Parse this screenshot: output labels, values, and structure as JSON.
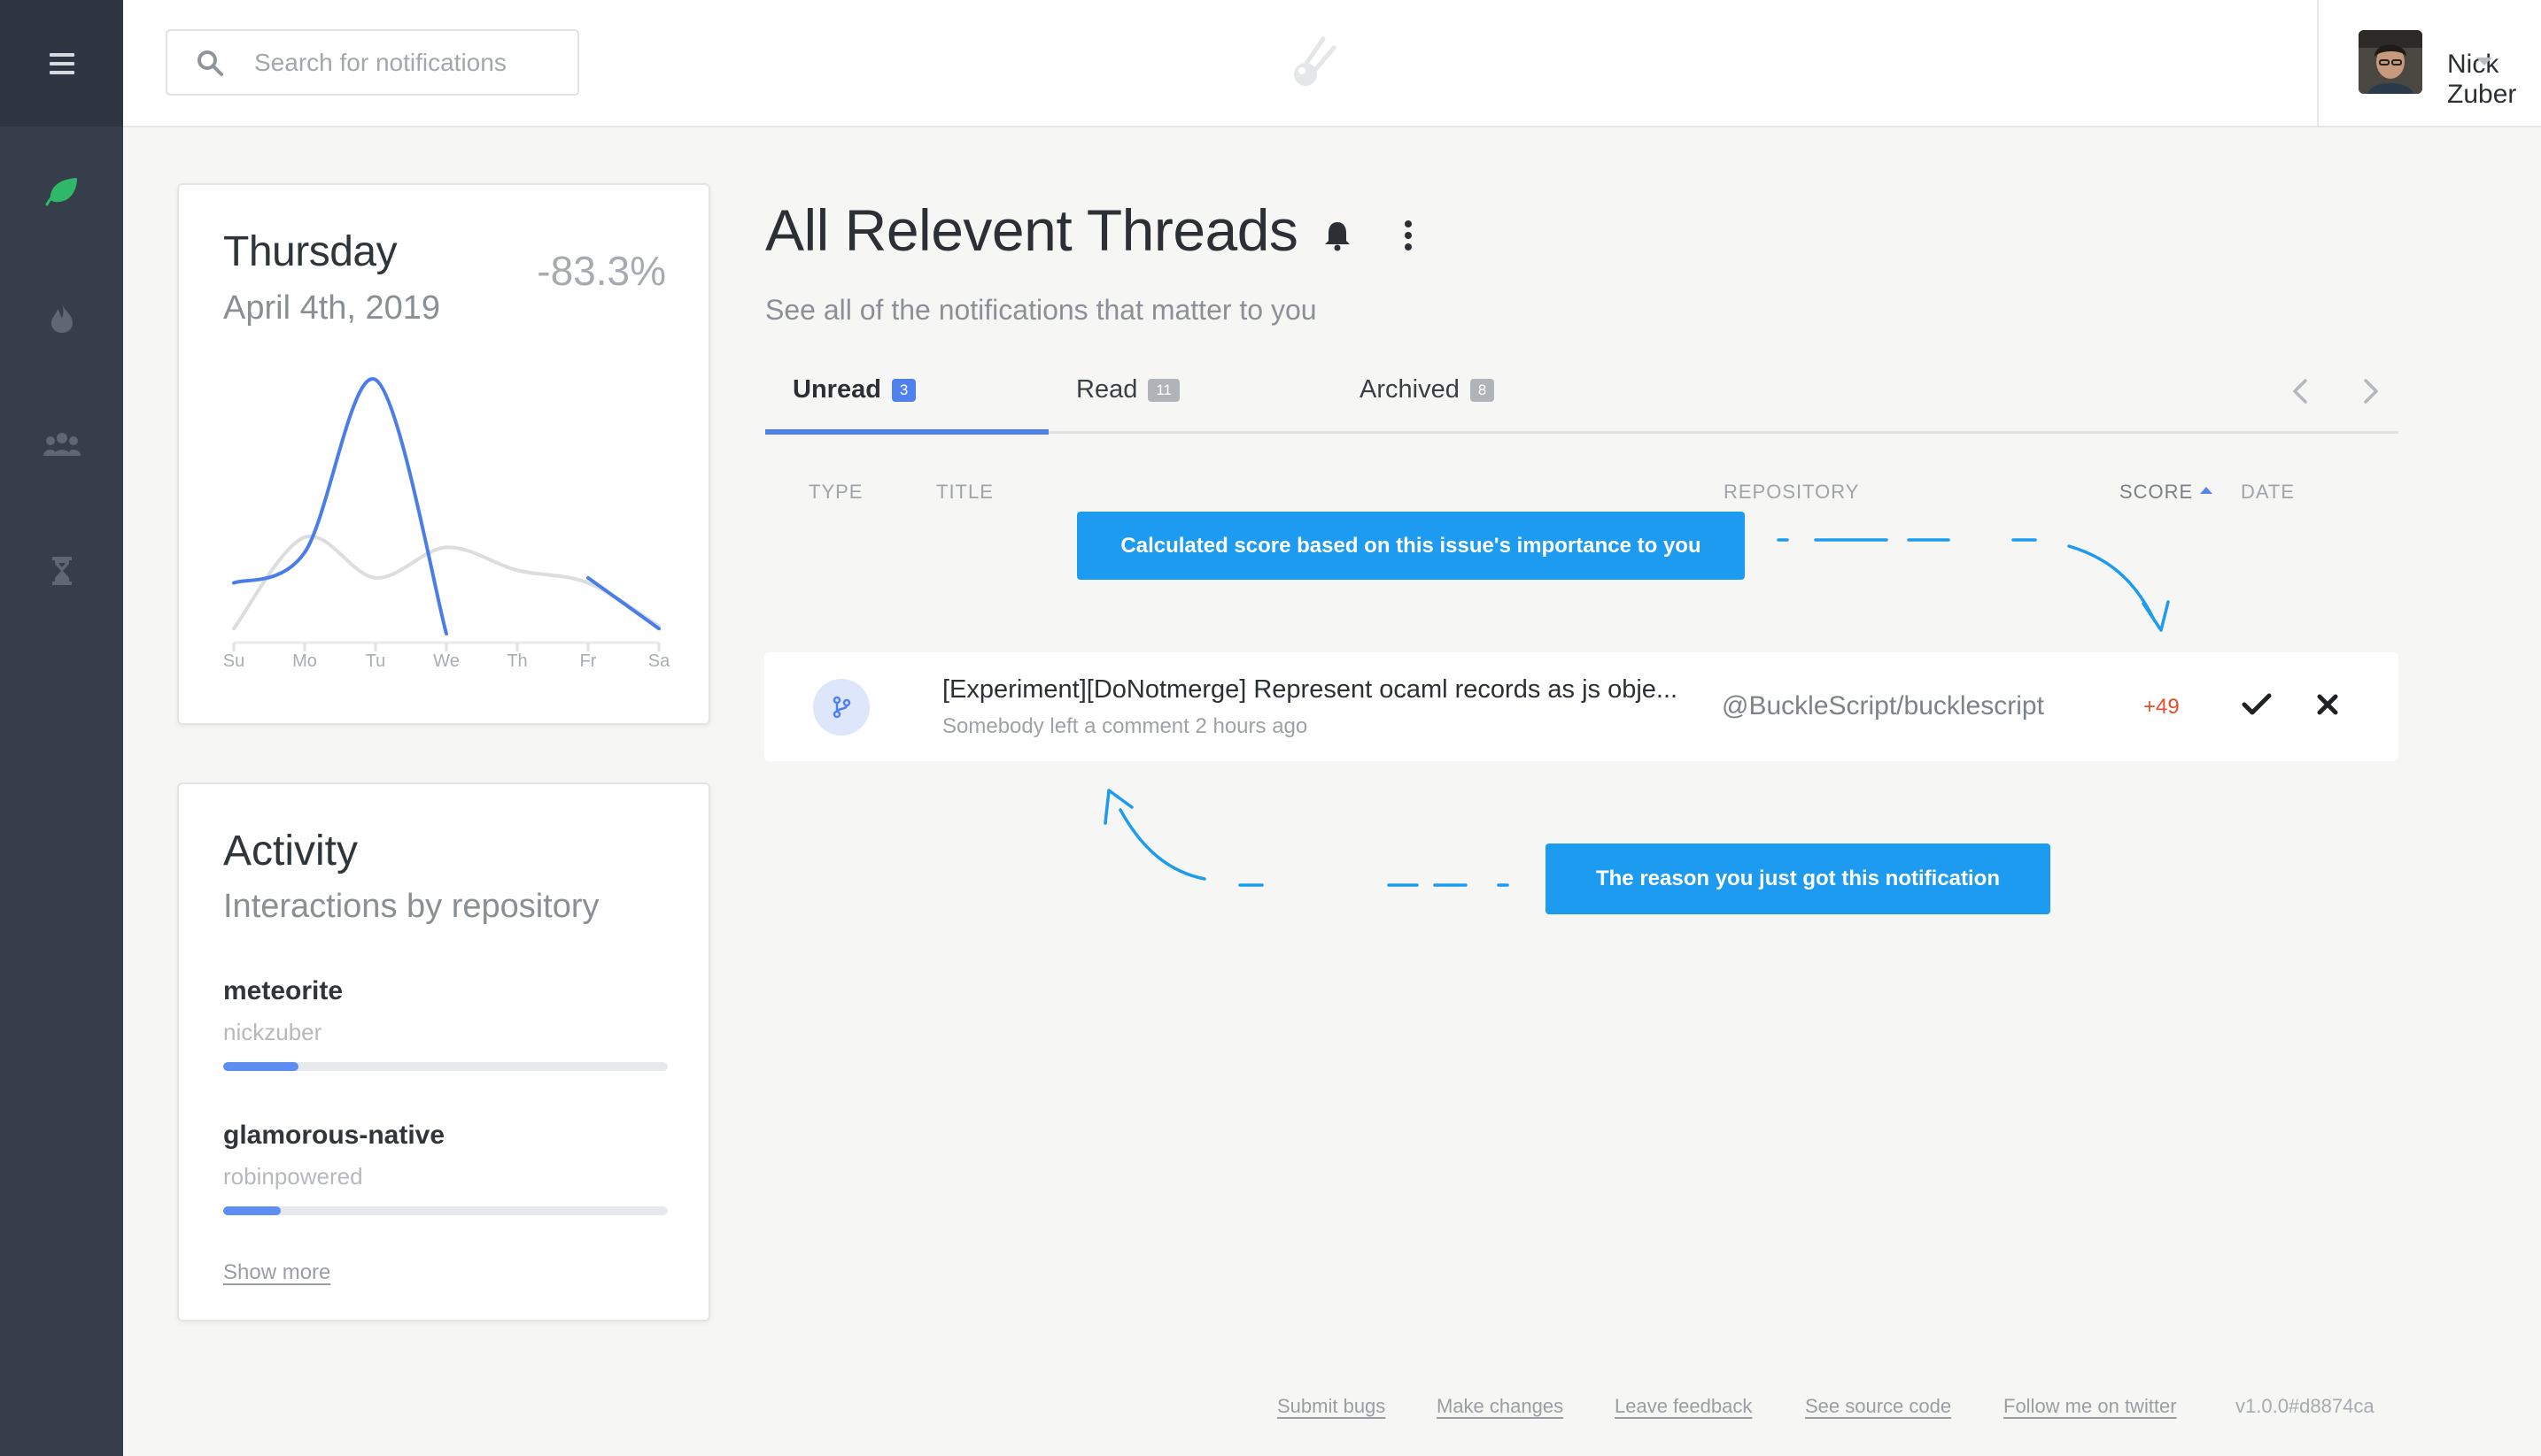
{
  "search": {
    "placeholder": "Search for notifications"
  },
  "user": {
    "name": "Nick Zuber"
  },
  "sidebar": {
    "items": [
      {
        "icon": "hamburger-icon"
      },
      {
        "icon": "leaf-icon",
        "active": true,
        "color": "#2fb86a"
      },
      {
        "icon": "flame-icon"
      },
      {
        "icon": "users-icon"
      },
      {
        "icon": "hourglass-icon"
      }
    ]
  },
  "day_card": {
    "day": "Thursday",
    "date": "April 4th, 2019",
    "change": "-83.3%"
  },
  "chart_data": {
    "type": "line",
    "categories": [
      "Su",
      "Mo",
      "Tu",
      "We",
      "Th",
      "Fr",
      "Sa"
    ],
    "series": [
      {
        "values": [
          0.2,
          0.32,
          1.0,
          0.0,
          null,
          0.22,
          0.02
        ],
        "color": "#4a7de8"
      },
      {
        "values": [
          0.02,
          0.38,
          0.22,
          0.34,
          0.25,
          0.2,
          0.03
        ],
        "color": "#dcdddf"
      }
    ],
    "xlabel": "",
    "ylabel": "",
    "grid": false
  },
  "activity": {
    "title": "Activity",
    "subtitle": "Interactions by repository",
    "repos": [
      {
        "name": "meteorite",
        "owner": "nickzuber",
        "share": 0.17
      },
      {
        "name": "glamorous-native",
        "owner": "robinpowered",
        "share": 0.13
      }
    ],
    "show_more": "Show more"
  },
  "main": {
    "title": "All Relevent Threads",
    "subtitle": "See all of the notifications that matter to you",
    "tabs": [
      {
        "label": "Unread",
        "count": "3",
        "active": true
      },
      {
        "label": "Read",
        "count": "11"
      },
      {
        "label": "Archived",
        "count": "8"
      }
    ],
    "columns": {
      "type": "TYPE",
      "title": "TITLE",
      "repository": "REPOSITORY",
      "score": "SCORE",
      "date": "DATE"
    },
    "rows": [
      {
        "icon": "git-branch-icon",
        "title": "[Experiment][DoNotmerge] Represent ocaml records as js obje...",
        "reason": "Somebody left a comment 2 hours ago",
        "repository": "@BuckleScript/bucklescript",
        "score": "+49"
      }
    ]
  },
  "tooltips": {
    "score": "Calculated score based on this issue's importance to you",
    "reason": "The reason you just got this notification"
  },
  "footer": {
    "links": [
      "Submit bugs",
      "Make changes",
      "Leave feedback",
      "See source code",
      "Follow me on twitter"
    ],
    "version": "v1.0.0#d8874ca"
  },
  "colors": {
    "accent": "#4f81ee",
    "tooltip": "#1d9bf0",
    "score": "#e2502d",
    "sidebar": "#363e4b"
  }
}
